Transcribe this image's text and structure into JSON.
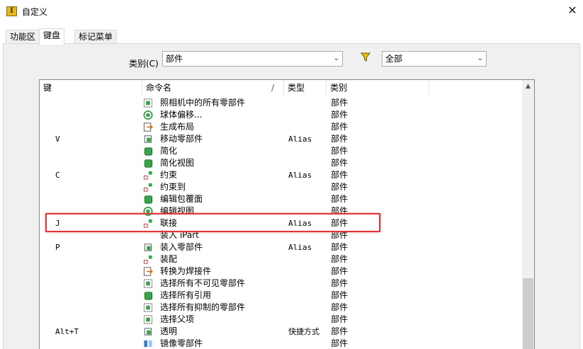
{
  "window": {
    "title": "自定义",
    "app_icon": "inventor-app-icon",
    "close": "✕"
  },
  "tabs": [
    {
      "label": "功能区",
      "active": false
    },
    {
      "label": "键盘",
      "active": true
    },
    {
      "label": "标记菜单",
      "active": false
    }
  ],
  "filter": {
    "category_label": "类别(C)",
    "category_value": "部件",
    "scope_value": "全部",
    "filter_icon": "funnel-icon"
  },
  "table": {
    "headers": {
      "key": "键",
      "command": "命令名",
      "type": "类型",
      "category": "类别"
    },
    "rows": [
      {
        "key": "",
        "icon": "photograph-parts-icon",
        "command": "照相机中的所有零部件",
        "type": "",
        "category": "部件"
      },
      {
        "key": "",
        "icon": "sphere-offset-icon",
        "command": "球体偏移...",
        "type": "",
        "category": "部件"
      },
      {
        "key": "",
        "icon": "create-layout-icon",
        "command": "生成布局",
        "type": "",
        "category": "部件"
      },
      {
        "key": "V",
        "icon": "move-component-icon",
        "command": "移动零部件",
        "type": "Alias",
        "category": "部件"
      },
      {
        "key": "",
        "icon": "simplify-icon",
        "command": "简化",
        "type": "",
        "category": "部件"
      },
      {
        "key": "",
        "icon": "simplified-view-icon",
        "command": "简化视图",
        "type": "",
        "category": "部件"
      },
      {
        "key": "C",
        "icon": "constraint-icon",
        "command": "约束",
        "type": "Alias",
        "category": "部件"
      },
      {
        "key": "",
        "icon": "constrain-to-icon",
        "command": "约束到",
        "type": "",
        "category": "部件"
      },
      {
        "key": "",
        "icon": "edit-envelope-icon",
        "command": "编辑包覆面",
        "type": "",
        "category": "部件"
      },
      {
        "key": "",
        "icon": "edit-view-icon",
        "command": "编辑视图",
        "type": "",
        "category": "部件"
      },
      {
        "key": "J",
        "icon": "joint-icon",
        "command": "联接",
        "type": "Alias",
        "category": "部件"
      },
      {
        "key": "",
        "icon": "",
        "command": "装入 iPart",
        "type": "",
        "category": "部件"
      },
      {
        "key": "P",
        "icon": "place-component-icon",
        "command": "装入零部件",
        "type": "Alias",
        "category": "部件"
      },
      {
        "key": "",
        "icon": "assemble-icon",
        "command": "装配",
        "type": "",
        "category": "部件"
      },
      {
        "key": "",
        "icon": "convert-to-weldment-icon",
        "command": "转换为焊接件",
        "type": "",
        "category": "部件"
      },
      {
        "key": "",
        "icon": "select-invisible-icon",
        "command": "选择所有不可见零部件",
        "type": "",
        "category": "部件"
      },
      {
        "key": "",
        "icon": "select-all-refs-icon",
        "command": "选择所有引用",
        "type": "",
        "category": "部件"
      },
      {
        "key": "",
        "icon": "select-suppressed-icon",
        "command": "选择所有抑制的零部件",
        "type": "",
        "category": "部件"
      },
      {
        "key": "",
        "icon": "select-parent-icon",
        "command": "选择父项",
        "type": "",
        "category": "部件"
      },
      {
        "key": "Alt+T",
        "icon": "transparent-icon",
        "command": "透明",
        "type": "快捷方式",
        "category": "部件"
      },
      {
        "key": "",
        "icon": "mirror-component-icon",
        "command": "镜像零部件",
        "type": "",
        "category": "部件"
      }
    ]
  },
  "colors": {
    "highlight": "#e0363a",
    "funnel": "#e3c300",
    "icon_green": "#3aa24a"
  }
}
